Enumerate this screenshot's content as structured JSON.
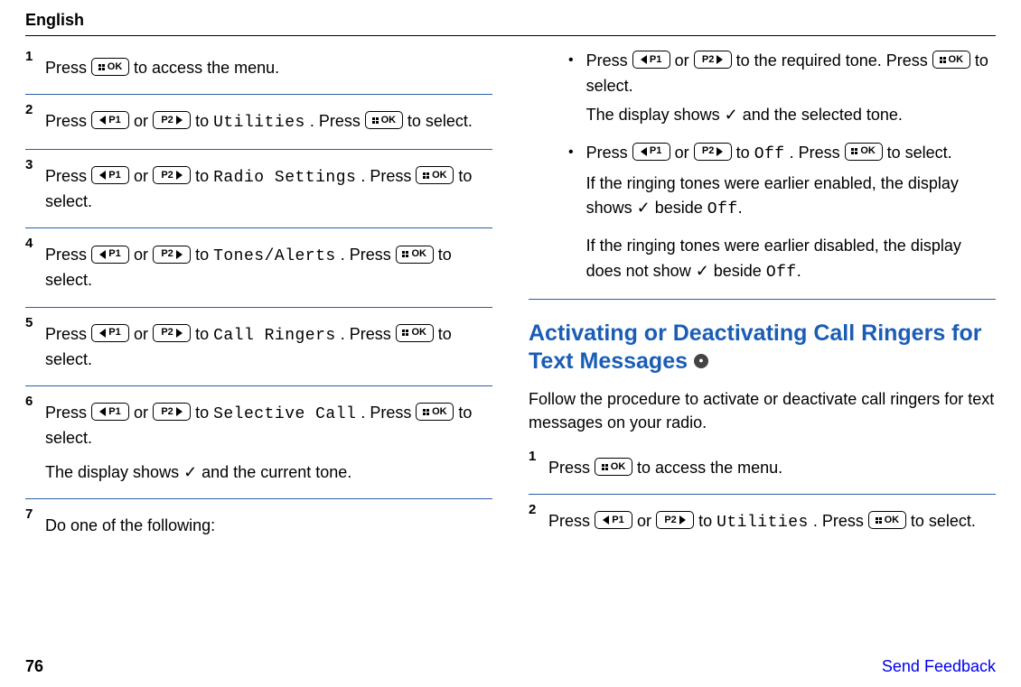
{
  "header": {
    "lang": "English"
  },
  "col1": {
    "steps": [
      {
        "n": "1",
        "pre": "Press ",
        "k1": "ok",
        "post": " to access the menu."
      },
      {
        "n": "2",
        "pre": "Press ",
        "k1": "p1",
        "mid1": " or ",
        "k2": "p2",
        "mid2": " to ",
        "code": "Utilities",
        "mid3": ". Press ",
        "k3": "ok",
        "post": " to select."
      },
      {
        "n": "3",
        "pre": "Press ",
        "k1": "p1",
        "mid1": " or ",
        "k2": "p2",
        "mid2": " to ",
        "code": "Radio Settings",
        "mid3": ". Press ",
        "k3": "ok",
        "post": " to select."
      },
      {
        "n": "4",
        "pre": "Press ",
        "k1": "p1",
        "mid1": " or ",
        "k2": "p2",
        "mid2": " to ",
        "code": "Tones/Alerts",
        "mid3": ". Press ",
        "k3": "ok",
        "post": " to select."
      },
      {
        "n": "5",
        "pre": "Press ",
        "k1": "p1",
        "mid1": " or ",
        "k2": "p2",
        "mid2": " to ",
        "code": "Call Ringers",
        "mid3": ". Press ",
        "k3": "ok",
        "post": " to select."
      },
      {
        "n": "6",
        "pre": "Press ",
        "k1": "p1",
        "mid1": " or ",
        "k2": "p2",
        "mid2": " to ",
        "code": "Selective Call",
        "mid3": ". Press ",
        "k3": "ok",
        "post": " to select.",
        "extra": "The display shows ✓ and the current tone."
      },
      {
        "n": "7",
        "text": "Do one of the following:"
      }
    ]
  },
  "col2": {
    "bullets": [
      {
        "l1a": "Press ",
        "l1b": " or ",
        "l1c": " to the required tone. Press ",
        "l1d": " to select.",
        "l2": "The display shows ✓ and the selected tone."
      },
      {
        "l1a": "Press ",
        "l1b": " or ",
        "l1c": " to ",
        "code1": "Off",
        "l1d": ". Press ",
        "l1e": " to select.",
        "l2a": "If the ringing tones were earlier enabled, the display shows ✓ beside ",
        "code2": "Off",
        "l2b": ".",
        "l3a": "If the ringing tones were earlier disabled, the display does not show ✓ beside ",
        "code3": "Off",
        "l3b": "."
      }
    ],
    "section": {
      "title": "Activating or Deactivating Call Ringers for Text Messages",
      "intro": "Follow the procedure to activate or deactivate call ringers for text messages on your radio.",
      "steps": [
        {
          "n": "1",
          "pre": "Press ",
          "k1": "ok",
          "post": " to access the menu."
        },
        {
          "n": "2",
          "pre": "Press ",
          "k1": "p1",
          "mid1": " or ",
          "k2": "p2",
          "mid2": " to ",
          "code": "Utilities",
          "mid3": ". Press ",
          "k3": "ok",
          "post": " to select."
        }
      ]
    }
  },
  "keys": {
    "p1": "P1",
    "p2": "P2",
    "ok": "OK"
  },
  "footer": {
    "page": "76",
    "link": "Send Feedback"
  }
}
